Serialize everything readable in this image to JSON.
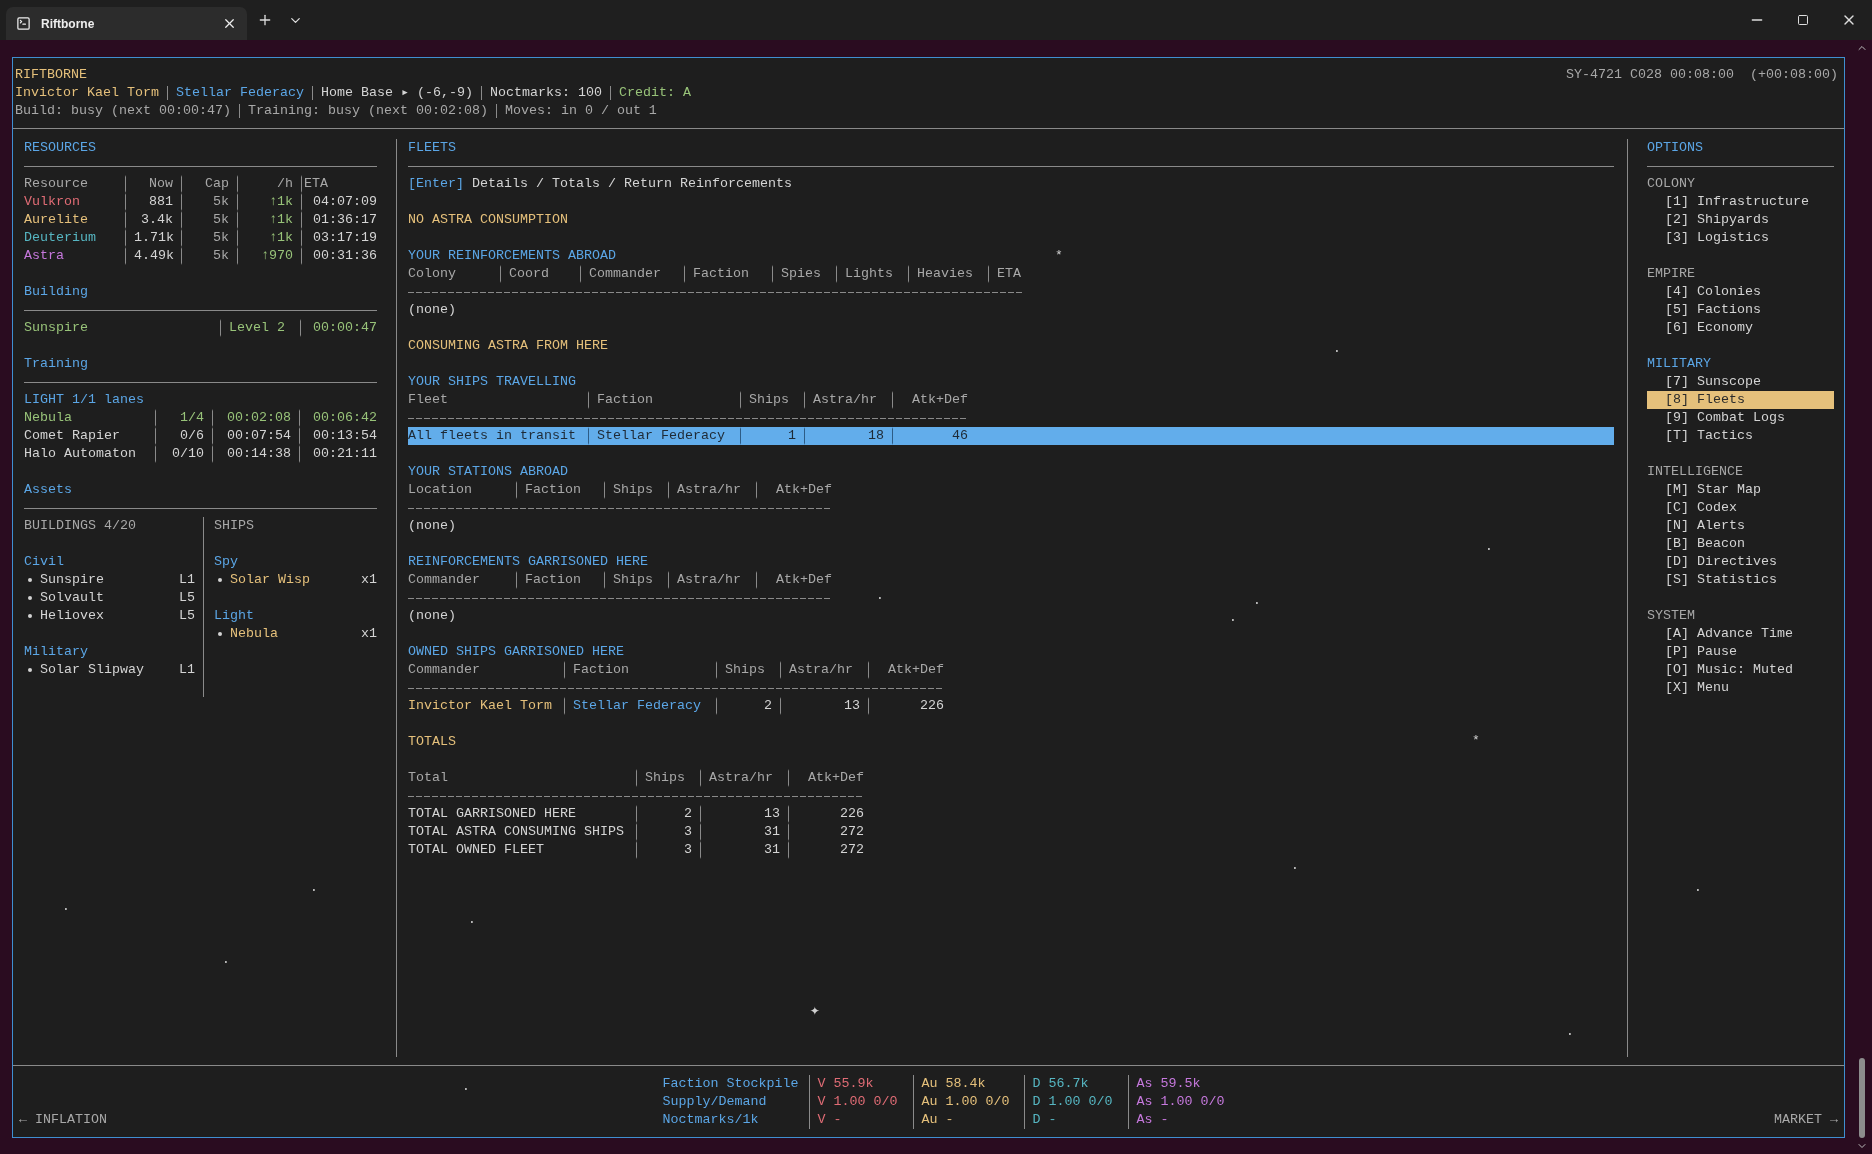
{
  "tab": {
    "title": "Riftborne"
  },
  "header": {
    "title": "RIFTBORNE",
    "clock": "SY-4721 C028 00:08:00  (+00:08:00)",
    "line": [
      {
        "kind": "commander",
        "text": "Invictor Kael Torm"
      },
      {
        "kind": "faction",
        "text": "Stellar Federacy"
      },
      {
        "kind": "plain",
        "text": "Home Base ▸ (-6,-9)"
      },
      {
        "kind": "plain",
        "text": "Noctmarks: 100"
      },
      {
        "kind": "credit",
        "text": "Credit: A"
      }
    ],
    "status": [
      "Build: busy (next 00:00:47)",
      "Training: busy (next 00:02:08)",
      "Moves: in 0 / out 1"
    ]
  },
  "resources": {
    "title": "RESOURCES",
    "columns": [
      "Resource",
      "Now",
      "Cap",
      "/h",
      "ETA"
    ],
    "rows": [
      {
        "name": "Vulkron",
        "color": "#e06c75",
        "now": "881",
        "cap": "5k",
        "rate": "↑1k",
        "eta": "04:07:09"
      },
      {
        "name": "Aurelite",
        "color": "#e5c07b",
        "now": "3.4k",
        "cap": "5k",
        "rate": "↑1k",
        "eta": "01:36:17"
      },
      {
        "name": "Deuterium",
        "color": "#56b6c2",
        "now": "1.71k",
        "cap": "5k",
        "rate": "↑1k",
        "eta": "03:17:19"
      },
      {
        "name": "Astra",
        "color": "#c678dd",
        "now": "4.49k",
        "cap": "5k",
        "rate": "↑970",
        "eta": "00:31:36"
      }
    ]
  },
  "building": {
    "title": "Building",
    "name": "Sunspire",
    "level": "Level 2",
    "time": "00:00:47"
  },
  "training": {
    "title": "Training",
    "lane": "LIGHT 1/1 lanes",
    "rows": [
      {
        "name": "Nebula",
        "count": "1/4",
        "next": "00:02:08",
        "done": "00:06:42",
        "active": true
      },
      {
        "name": "Comet Rapier",
        "count": "0/6",
        "next": "00:07:54",
        "done": "00:13:54",
        "active": false
      },
      {
        "name": "Halo Automaton",
        "count": "0/10",
        "next": "00:14:38",
        "done": "00:21:11",
        "active": false
      }
    ]
  },
  "assets": {
    "title": "Assets",
    "buildings": {
      "title": "BUILDINGS 4/20",
      "groups": [
        {
          "name": "Civil",
          "items": [
            {
              "name": "Sunspire",
              "value": "L1"
            },
            {
              "name": "Solvault",
              "value": "L5"
            },
            {
              "name": "Heliovex",
              "value": "L5"
            }
          ]
        },
        {
          "name": "Military",
          "items": [
            {
              "name": "Solar Slipway",
              "value": "L1"
            }
          ]
        }
      ]
    },
    "ships": {
      "title": "SHIPS",
      "groups": [
        {
          "name": "Spy",
          "items": [
            {
              "name": "Solar Wisp",
              "value": "x1"
            }
          ]
        },
        {
          "name": "Light",
          "items": [
            {
              "name": "Nebula",
              "value": "x1"
            }
          ]
        }
      ]
    }
  },
  "fleets": {
    "title": "FLEETS",
    "hint_key": "[Enter]",
    "hint": "Details / Totals / Return Reinforcements",
    "sections": [
      {
        "kind": "notice",
        "text": "NO ASTRA CONSUMPTION"
      },
      {
        "kind": "table",
        "title": "YOUR REINFORCEMENTS ABROAD",
        "columns": [
          "Colony",
          "Coord",
          "Commander",
          "Faction",
          "Spies",
          "Lights",
          "Heavies",
          "ETA"
        ],
        "empty": "(none)"
      },
      {
        "kind": "notice",
        "text": "CONSUMING ASTRA FROM HERE"
      },
      {
        "kind": "table",
        "title": "YOUR SHIPS TRAVELLING",
        "columns": [
          "Fleet",
          "Faction",
          "Ships",
          "Astra/hr",
          "Atk+Def"
        ],
        "rows": [
          {
            "kind": "plain",
            "selected": true,
            "cells": [
              "All fleets in transit",
              "Stellar Federacy",
              "1",
              "18",
              "46"
            ]
          }
        ]
      },
      {
        "kind": "table",
        "title": "YOUR STATIONS ABROAD",
        "columns": [
          "Location",
          "Faction",
          "Ships",
          "Astra/hr",
          "Atk+Def"
        ],
        "empty": "(none)"
      },
      {
        "kind": "table",
        "title": "REINFORCEMENTS GARRISONED HERE",
        "columns": [
          "Commander",
          "Faction",
          "Ships",
          "Astra/hr",
          "Atk+Def"
        ],
        "empty": "(none)"
      },
      {
        "kind": "table",
        "title": "OWNED SHIPS GARRISONED HERE",
        "columns": [
          "Commander",
          "Faction",
          "Ships",
          "Astra/hr",
          "Atk+Def"
        ],
        "rows": [
          {
            "kind": "commander",
            "selected": false,
            "cells": [
              "Invictor Kael Torm",
              "Stellar Federacy",
              "2",
              "13",
              "226"
            ]
          }
        ]
      },
      {
        "kind": "notice",
        "text": "TOTALS"
      },
      {
        "kind": "table",
        "columns": [
          "Total",
          "Ships",
          "Astra/hr",
          "Atk+Def"
        ],
        "rows": [
          {
            "kind": "plain",
            "selected": false,
            "cells": [
              "TOTAL GARRISONED HERE",
              "2",
              "13",
              "226"
            ]
          },
          {
            "kind": "plain",
            "selected": false,
            "cells": [
              "TOTAL ASTRA CONSUMING SHIPS",
              "3",
              "31",
              "272"
            ]
          },
          {
            "kind": "plain",
            "selected": false,
            "cells": [
              "TOTAL OWNED FLEET",
              "3",
              "31",
              "272"
            ]
          }
        ]
      }
    ]
  },
  "options": {
    "title": "OPTIONS",
    "groups": [
      {
        "name": "COLONY",
        "active": false,
        "items": [
          {
            "key": "[1]",
            "label": "Infrastructure",
            "selected": false
          },
          {
            "key": "[2]",
            "label": "Shipyards",
            "selected": false
          },
          {
            "key": "[3]",
            "label": "Logistics",
            "selected": false
          }
        ]
      },
      {
        "name": "EMPIRE",
        "active": false,
        "items": [
          {
            "key": "[4]",
            "label": "Colonies",
            "selected": false
          },
          {
            "key": "[5]",
            "label": "Factions",
            "selected": false
          },
          {
            "key": "[6]",
            "label": "Economy",
            "selected": false
          }
        ]
      },
      {
        "name": "MILITARY",
        "active": true,
        "items": [
          {
            "key": "[7]",
            "label": "Sunscope",
            "selected": false
          },
          {
            "key": "[8]",
            "label": "Fleets",
            "selected": true
          },
          {
            "key": "[9]",
            "label": "Combat Logs",
            "selected": false
          },
          {
            "key": "[T]",
            "label": "Tactics",
            "selected": false
          }
        ]
      },
      {
        "name": "INTELLIGENCE",
        "active": false,
        "items": [
          {
            "key": "[M]",
            "label": "Star Map",
            "selected": false
          },
          {
            "key": "[C]",
            "label": "Codex",
            "selected": false
          },
          {
            "key": "[N]",
            "label": "Alerts",
            "selected": false
          },
          {
            "key": "[B]",
            "label": "Beacon",
            "selected": false
          },
          {
            "key": "[D]",
            "label": "Directives",
            "selected": false
          },
          {
            "key": "[S]",
            "label": "Statistics",
            "selected": false
          }
        ]
      },
      {
        "name": "SYSTEM",
        "active": false,
        "items": [
          {
            "key": "[A]",
            "label": "Advance Time",
            "selected": false
          },
          {
            "key": "[P]",
            "label": "Pause",
            "selected": false
          },
          {
            "key": "[O]",
            "label": "Music: Muted",
            "selected": false
          },
          {
            "key": "[X]",
            "label": "Menu",
            "selected": false
          }
        ]
      }
    ]
  },
  "market": {
    "left": "← INFLATION",
    "right": "MARKET →",
    "labels": [
      "Faction Stockpile",
      "Supply/Demand",
      "Noctmarks/1k"
    ],
    "columns": [
      {
        "color": "#e06c75",
        "values": [
          "V 55.9k",
          "V 1.00 0/0",
          "V -"
        ]
      },
      {
        "color": "#e5c07b",
        "values": [
          "Au 58.4k",
          "Au 1.00 0/0",
          "Au -"
        ]
      },
      {
        "color": "#56b6c2",
        "values": [
          "D 56.7k",
          "D 1.00 0/0",
          "D -"
        ]
      },
      {
        "color": "#c678dd",
        "values": [
          "As 59.5k",
          "As 1.00 0/0",
          "As -"
        ]
      }
    ]
  },
  "starfield": [
    "*",
    "*",
    "✦",
    ".",
    ".",
    ".",
    ".",
    ".",
    ".",
    ".",
    ".",
    ".",
    ".",
    ".",
    ".",
    "."
  ]
}
